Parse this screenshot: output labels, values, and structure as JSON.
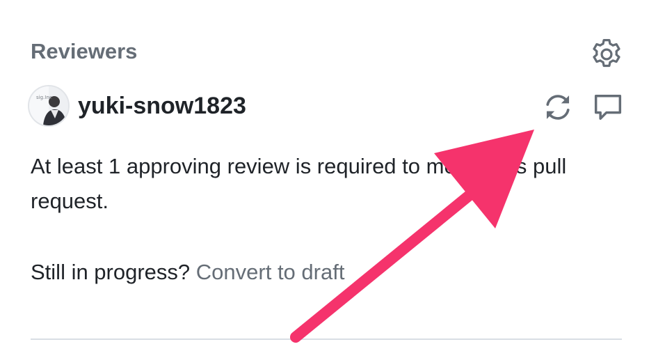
{
  "reviewers": {
    "heading": "Reviewers",
    "settings_icon": "gear-icon",
    "reviewer": {
      "username": "yuki-snow1823",
      "avatar_text": "sig.Inc",
      "rerequest_icon": "sync-icon",
      "comment_icon": "comment-icon"
    },
    "notice": "At least 1 approving review is required to merge this pull request.",
    "draft_prompt": "Still in progress?",
    "draft_link": "Convert to draft"
  },
  "annotation": {
    "arrow_color": "#f5336c"
  }
}
